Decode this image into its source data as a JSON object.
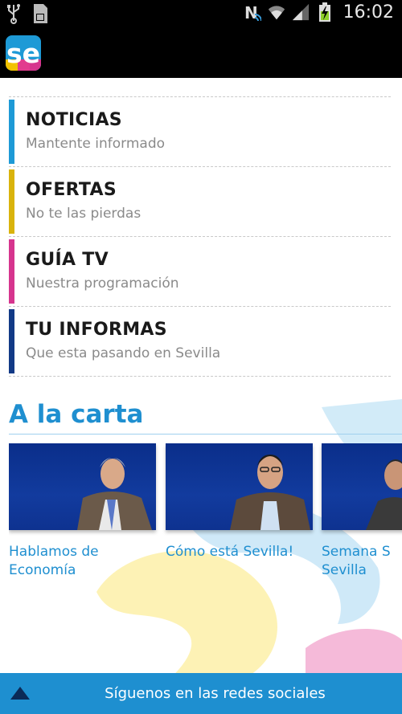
{
  "status_bar": {
    "time": "16:02",
    "icons": [
      "usb-icon",
      "sd-card-icon",
      "nfc-icon",
      "wifi-icon",
      "signal-icon",
      "battery-charging-icon"
    ]
  },
  "app": {
    "logo_text": "se"
  },
  "menu": [
    {
      "title": "NOTICIAS",
      "subtitle": "Mantente informado",
      "color": "#1e9ad6"
    },
    {
      "title": "OFERTAS",
      "subtitle": "No te las pierdas",
      "color": "#d9b30c"
    },
    {
      "title": "GUÍA TV",
      "subtitle": "Nuestra programación",
      "color": "#d6358e"
    },
    {
      "title": "TU INFORMAS",
      "subtitle": "Que esta pasando en Sevilla",
      "color": "#123a86"
    }
  ],
  "a_la_carta": {
    "title": "A la carta",
    "items": [
      {
        "caption_line1": "Hablamos de",
        "caption_line2": "Economía"
      },
      {
        "caption_line1": "Cómo está Sevilla!",
        "caption_line2": ""
      },
      {
        "caption_line1": "Semana S",
        "caption_line2": "Sevilla"
      }
    ]
  },
  "footer": {
    "label": "Síguenos en las redes sociales"
  },
  "colors": {
    "accent": "#1f8fd0",
    "footer_bg": "#1e8fd0"
  }
}
